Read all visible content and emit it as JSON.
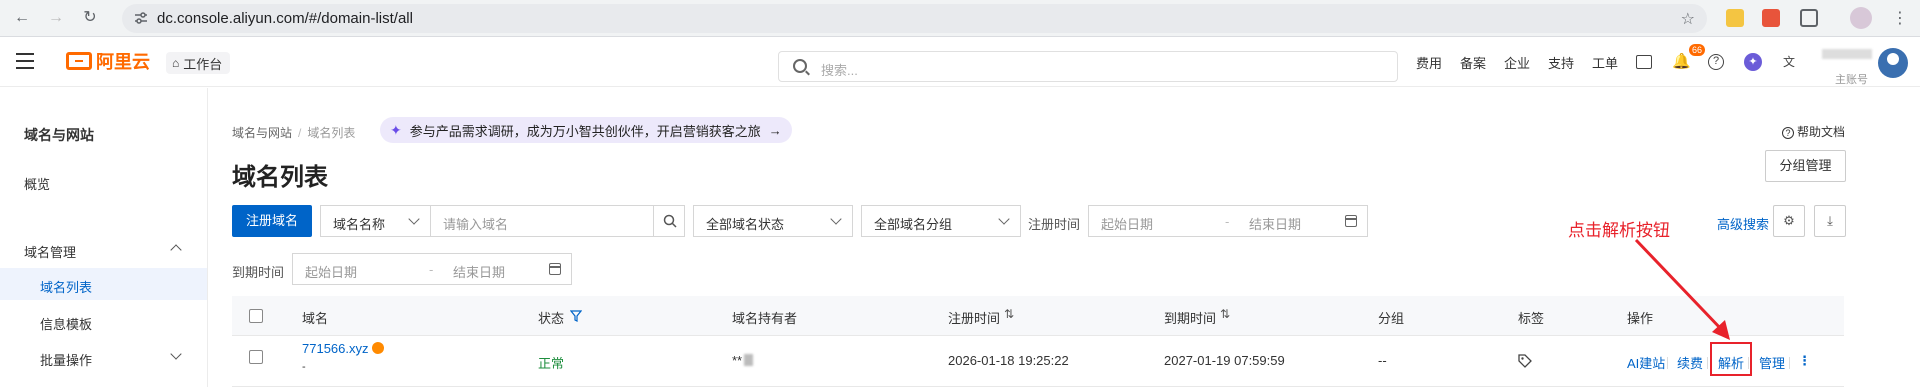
{
  "browser": {
    "url": "dc.console.aliyun.com/#/domain-list/all"
  },
  "topbar": {
    "logo_text": "阿里云",
    "workbench_label": "工作台",
    "search_placeholder": "搜索...",
    "links": [
      "费用",
      "备案",
      "企业",
      "支持",
      "工单"
    ],
    "notification_count": "66",
    "account_sub_label": "主账号"
  },
  "sidebar": {
    "title": "域名与网站",
    "overview": "概览",
    "group_domain_mgmt": "域名管理",
    "items": [
      "域名列表",
      "信息模板",
      "批量操作"
    ]
  },
  "breadcrumb": [
    "域名与网站",
    "域名列表"
  ],
  "promo_text": "参与产品需求调研，成为万小智共创伙伴，开启营销获客之旅",
  "help_label": "帮助文档",
  "page_title": "域名列表",
  "group_manage_label": "分组管理",
  "toolbar": {
    "register_label": "注册域名",
    "field_select": "域名名称",
    "domain_input_placeholder": "请输入域名",
    "status_select": "全部域名状态",
    "group_select": "全部域名分组",
    "reg_time_label": "注册时间",
    "start_date_placeholder": "起始日期",
    "end_date_placeholder": "结束日期",
    "expire_time_label": "到期时间",
    "advanced_search_label": "高级搜索"
  },
  "table": {
    "columns": [
      "域名",
      "状态",
      "域名持有者",
      "注册时间",
      "到期时间",
      "分组",
      "标签",
      "操作"
    ],
    "rows": [
      {
        "domain": "771566.xyz",
        "domain_sub": "-",
        "status": "正常",
        "holder": "**",
        "reg_time": "2026-01-18 19:25:22",
        "expire_time": "2027-01-19 07:59:59",
        "group": "--",
        "actions": [
          "AI建站",
          "续费",
          "解析",
          "管理"
        ]
      }
    ]
  },
  "annotation": {
    "text": "点击解析按钮",
    "color": "#e8222b"
  },
  "colors": {
    "primary": "#0064c8",
    "brand": "#ff6a00",
    "status_ok": "#1e8e3e"
  }
}
